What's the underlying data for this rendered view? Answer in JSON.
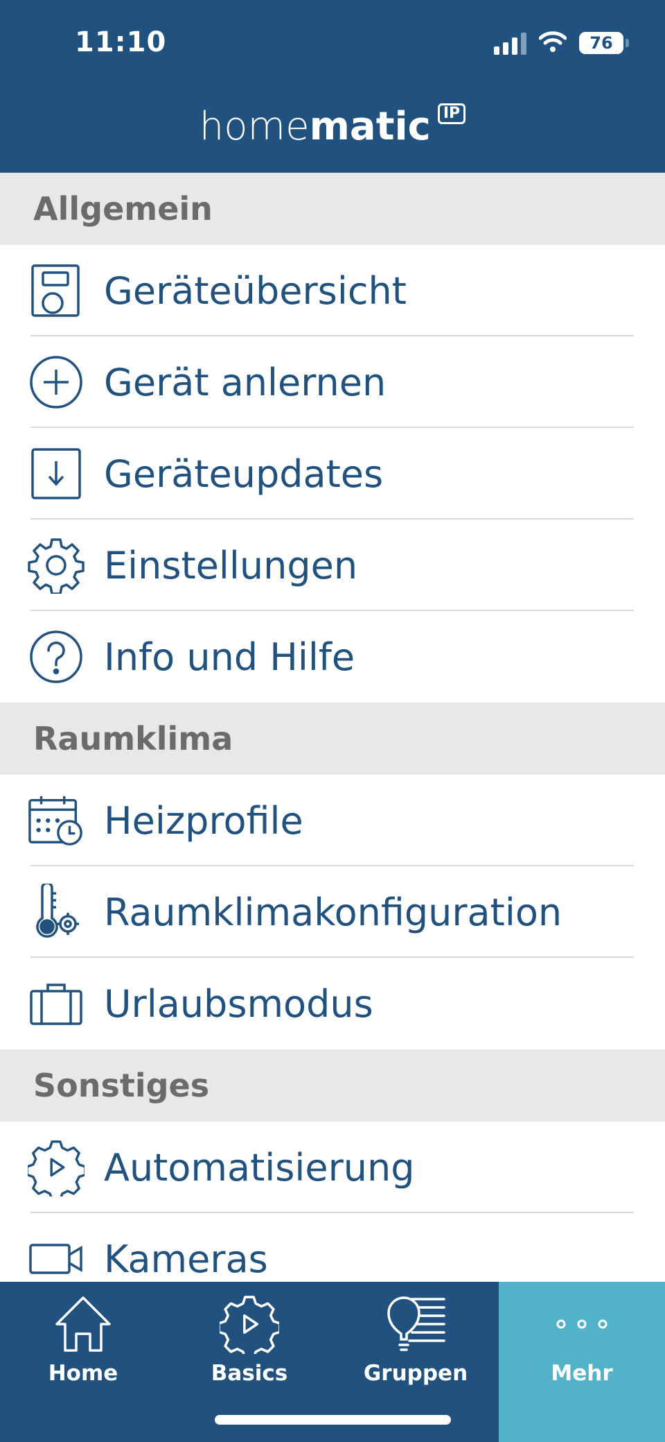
{
  "status_bar": {
    "time": "11:10",
    "battery": "76"
  },
  "header": {
    "logo_light": "home",
    "logo_bold": "matic",
    "logo_badge": "IP"
  },
  "sections": [
    {
      "title": "Allgemein",
      "items": [
        {
          "label": "Geräteübersicht",
          "icon": "device-overview-icon"
        },
        {
          "label": "Gerät anlernen",
          "icon": "add-circle-icon"
        },
        {
          "label": "Geräteupdates",
          "icon": "download-icon"
        },
        {
          "label": "Einstellungen",
          "icon": "gear-icon"
        },
        {
          "label": "Info und Hilfe",
          "icon": "help-circle-icon"
        }
      ]
    },
    {
      "title": "Raumklima",
      "items": [
        {
          "label": "Heizprofile",
          "icon": "calendar-clock-icon"
        },
        {
          "label": "Raumklimakonfiguration",
          "icon": "thermometer-gear-icon"
        },
        {
          "label": "Urlaubsmodus",
          "icon": "suitcase-icon"
        }
      ]
    },
    {
      "title": "Sonstiges",
      "items": [
        {
          "label": "Automatisierung",
          "icon": "gear-play-icon"
        },
        {
          "label": "Kameras",
          "icon": "camera-icon"
        }
      ]
    }
  ],
  "tabbar": {
    "tabs": [
      {
        "label": "Home",
        "icon": "house-icon"
      },
      {
        "label": "Basics",
        "icon": "gear-play-icon"
      },
      {
        "label": "Gruppen",
        "icon": "bulb-lines-icon"
      },
      {
        "label": "Mehr",
        "icon": "more-dots-icon"
      }
    ],
    "active": "Mehr"
  },
  "colors": {
    "brand": "#21527f",
    "active_tab": "#52b3c8",
    "section_bg": "#e6e8ea",
    "section_text": "#6b6b6b"
  }
}
